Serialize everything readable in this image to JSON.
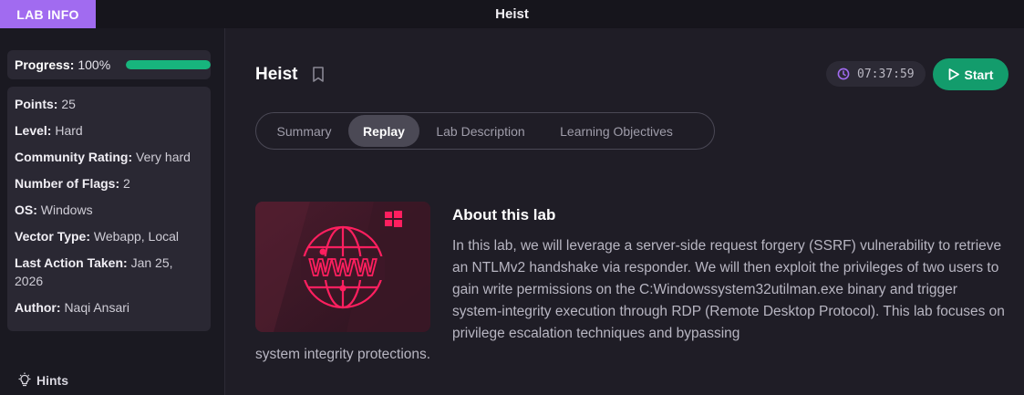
{
  "topbar": {
    "lab_info_tab": "LAB INFO",
    "window_title": "Heist"
  },
  "sidebar": {
    "progress_label": "Progress:",
    "progress_value": "100%",
    "progress_fraction": 1.0,
    "info": [
      {
        "key": "Points:",
        "value": "25"
      },
      {
        "key": "Level:",
        "value": "Hard"
      },
      {
        "key": "Community Rating:",
        "value": "Very hard"
      },
      {
        "key": "Number of Flags:",
        "value": "2"
      },
      {
        "key": "OS:",
        "value": "Windows"
      },
      {
        "key": "Vector Type:",
        "value": "Webapp, Local"
      },
      {
        "key": "Last Action Taken:",
        "value": "Jan 25, 2026"
      },
      {
        "key": "Author:",
        "value": "Naqi Ansari"
      }
    ],
    "hints_label": "Hints"
  },
  "main": {
    "title": "Heist",
    "timer": "07:37:59",
    "start_label": "Start",
    "tabs": [
      {
        "label": "Summary",
        "active": false
      },
      {
        "label": "Replay",
        "active": true
      },
      {
        "label": "Lab Description",
        "active": false
      },
      {
        "label": "Learning Objectives",
        "active": false
      }
    ],
    "about_title": "About this lab",
    "about_text_wrapped": "In this lab, we will leverage a server-side request forgery (SSRF) vulnerability to retrieve an NTLMv2 handshake via responder. We will then exploit the privileges of two users to gain write permissions on the C:Windowssystem32utilman.exe binary and trigger system-integrity execution through RDP (Remote Desktop Protocol). This lab focuses on privilege escalation techniques and bypassing",
    "about_text_tail": "system integrity protections."
  },
  "colors": {
    "accent_purple": "#a16bf0",
    "progress_green": "#17b57d",
    "start_green": "#139c6c",
    "brand_pink": "#ff1f5f"
  },
  "icons": {
    "bookmark": "bookmark-icon",
    "timer": "clock-icon",
    "start": "play-icon",
    "hints": "lightbulb-icon",
    "windows": "windows-logo-icon",
    "www": "www-globe-icon"
  }
}
